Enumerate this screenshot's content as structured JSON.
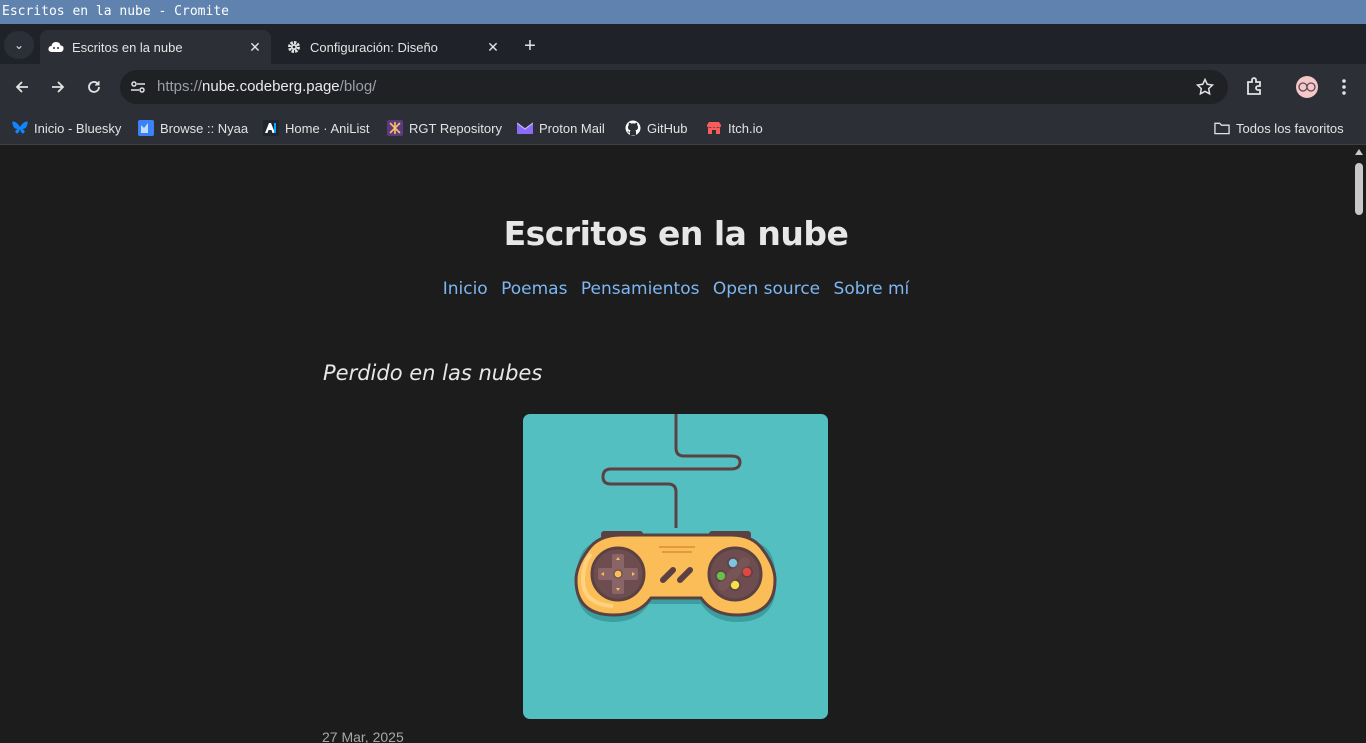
{
  "window": {
    "title": "Escritos en la nube - Cromite"
  },
  "tabs": [
    {
      "label": "Escritos en la nube",
      "icon": "cloud-icon",
      "active": true
    },
    {
      "label": "Configuración: Diseño",
      "icon": "gear-icon",
      "active": false
    }
  ],
  "address_bar": {
    "scheme": "https://",
    "host": "nube.codeberg.page",
    "path": "/blog/"
  },
  "bookmarks": [
    {
      "label": "Inicio - Bluesky",
      "icon": "bluesky-icon"
    },
    {
      "label": "Browse :: Nyaa",
      "icon": "nyaa-icon"
    },
    {
      "label": "Home · AniList",
      "icon": "anilist-icon"
    },
    {
      "label": "RGT Repository",
      "icon": "rgt-icon"
    },
    {
      "label": "Proton Mail",
      "icon": "protonmail-icon"
    },
    {
      "label": "GitHub",
      "icon": "github-icon"
    },
    {
      "label": "Itch.io",
      "icon": "itchio-icon"
    }
  ],
  "all_bookmarks_label": "Todos los favoritos",
  "site": {
    "title": "Escritos en la nube",
    "nav": [
      "Inicio",
      "Poemas",
      "Pensamientos",
      "Open source",
      "Sobre mí"
    ]
  },
  "post": {
    "title": "Perdido en las nubes",
    "image_icon": "game-controller-icon",
    "date": "27 Mar, 2025"
  },
  "colors": {
    "titlebar": "#5f82ae",
    "link": "#7db6f2",
    "image_bg": "#54bfc0",
    "page_bg": "#1c1c1c"
  }
}
